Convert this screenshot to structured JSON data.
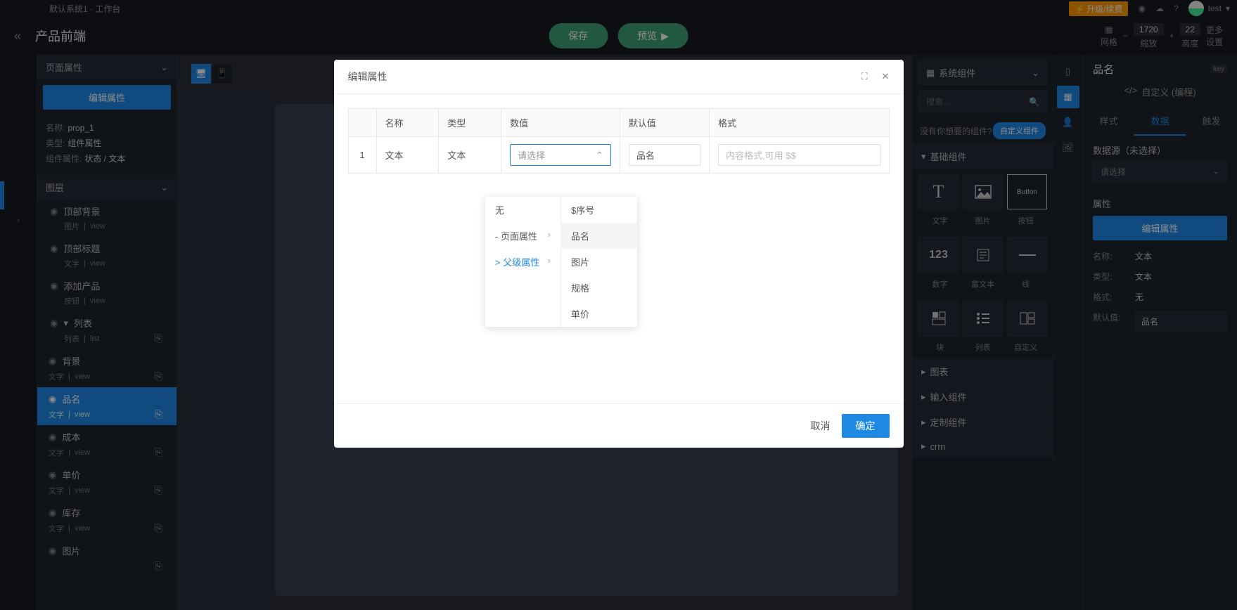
{
  "topbar": {
    "title": "默认系统1 · 工作台",
    "upgrade": "升级/续费",
    "user": "test"
  },
  "toolbar": {
    "title": "产品前端",
    "save": "保存",
    "preview": "预览",
    "grid_label": "网格",
    "zoom_label": "缩放",
    "zoom_val": "1720",
    "height_label": "高度",
    "height_val": "22",
    "more": "更多\n设置"
  },
  "left": {
    "page_prop": "页面属性",
    "edit_btn": "编辑属性",
    "name_k": "名称:",
    "name_v": "prop_1",
    "type_k": "类型:",
    "type_v": "组件属性",
    "comp_k": "组件属性:",
    "comp_v": "状态 / 文本",
    "layers_head": "图层",
    "layers": [
      {
        "name": "顶部背景",
        "sub": "图片",
        "view": "view"
      },
      {
        "name": "顶部标题",
        "sub": "文字",
        "view": "view"
      },
      {
        "name": "添加产品",
        "sub": "按钮",
        "view": "view"
      },
      {
        "name": "列表",
        "sub": "列表",
        "view": "list",
        "link": true,
        "expand": true
      },
      {
        "name": "背景",
        "sub": "文字",
        "view": "view",
        "indent": true,
        "link": true
      },
      {
        "name": "品名",
        "sub": "文字",
        "view": "view",
        "indent": true,
        "selected": true,
        "link": true
      },
      {
        "name": "成本",
        "sub": "文字",
        "view": "view",
        "indent": true,
        "link": true
      },
      {
        "name": "单价",
        "sub": "文字",
        "view": "view",
        "indent": true,
        "link": true
      },
      {
        "name": "库存",
        "sub": "文字",
        "view": "view",
        "indent": true,
        "link": true
      },
      {
        "name": "图片",
        "sub": "",
        "view": "",
        "indent": true,
        "link": true
      }
    ]
  },
  "comp": {
    "selector": "系统组件",
    "search_ph": "搜索...",
    "hint": "没有你想要的组件?",
    "custom_btn": "自定义组件",
    "group_basic": "基础组件",
    "row1": [
      "文字",
      "图片",
      "按钮"
    ],
    "row2": [
      "数字",
      "富文本",
      "线"
    ],
    "row3": [
      "块",
      "列表",
      "自定义"
    ],
    "groups": [
      "图表",
      "输入组件",
      "定制组件",
      "crm"
    ],
    "icon_text": "T",
    "icon_num": "123",
    "icon_btn": "Button"
  },
  "right": {
    "title": "品名",
    "custom": "自定义 (编程)",
    "tabs": [
      "样式",
      "数据",
      "触发"
    ],
    "ds_label": "数据源（未选择）",
    "ds_ph": "请选择",
    "prop_label": "属性",
    "edit_btn": "编辑属性",
    "name_k": "名称:",
    "name_v": "文本",
    "type_k": "类型:",
    "type_v": "文本",
    "fmt_k": "格式:",
    "fmt_v": "无",
    "def_k": "默认值:",
    "def_v": "品名"
  },
  "modal": {
    "title": "编辑属性",
    "cols": [
      "",
      "名称",
      "类型",
      "数值",
      "默认值",
      "格式"
    ],
    "row": {
      "idx": "1",
      "name": "文本",
      "type": "文本",
      "value_ph": "请选择",
      "default": "品名",
      "fmt_ph": "内容格式,可用 $$"
    },
    "cancel": "取消",
    "ok": "确定",
    "cascade1": [
      "无",
      "- 页面属性",
      "> 父级属性"
    ],
    "cascade2": [
      "$序号",
      "品名",
      "图片",
      "规格",
      "单价"
    ]
  }
}
